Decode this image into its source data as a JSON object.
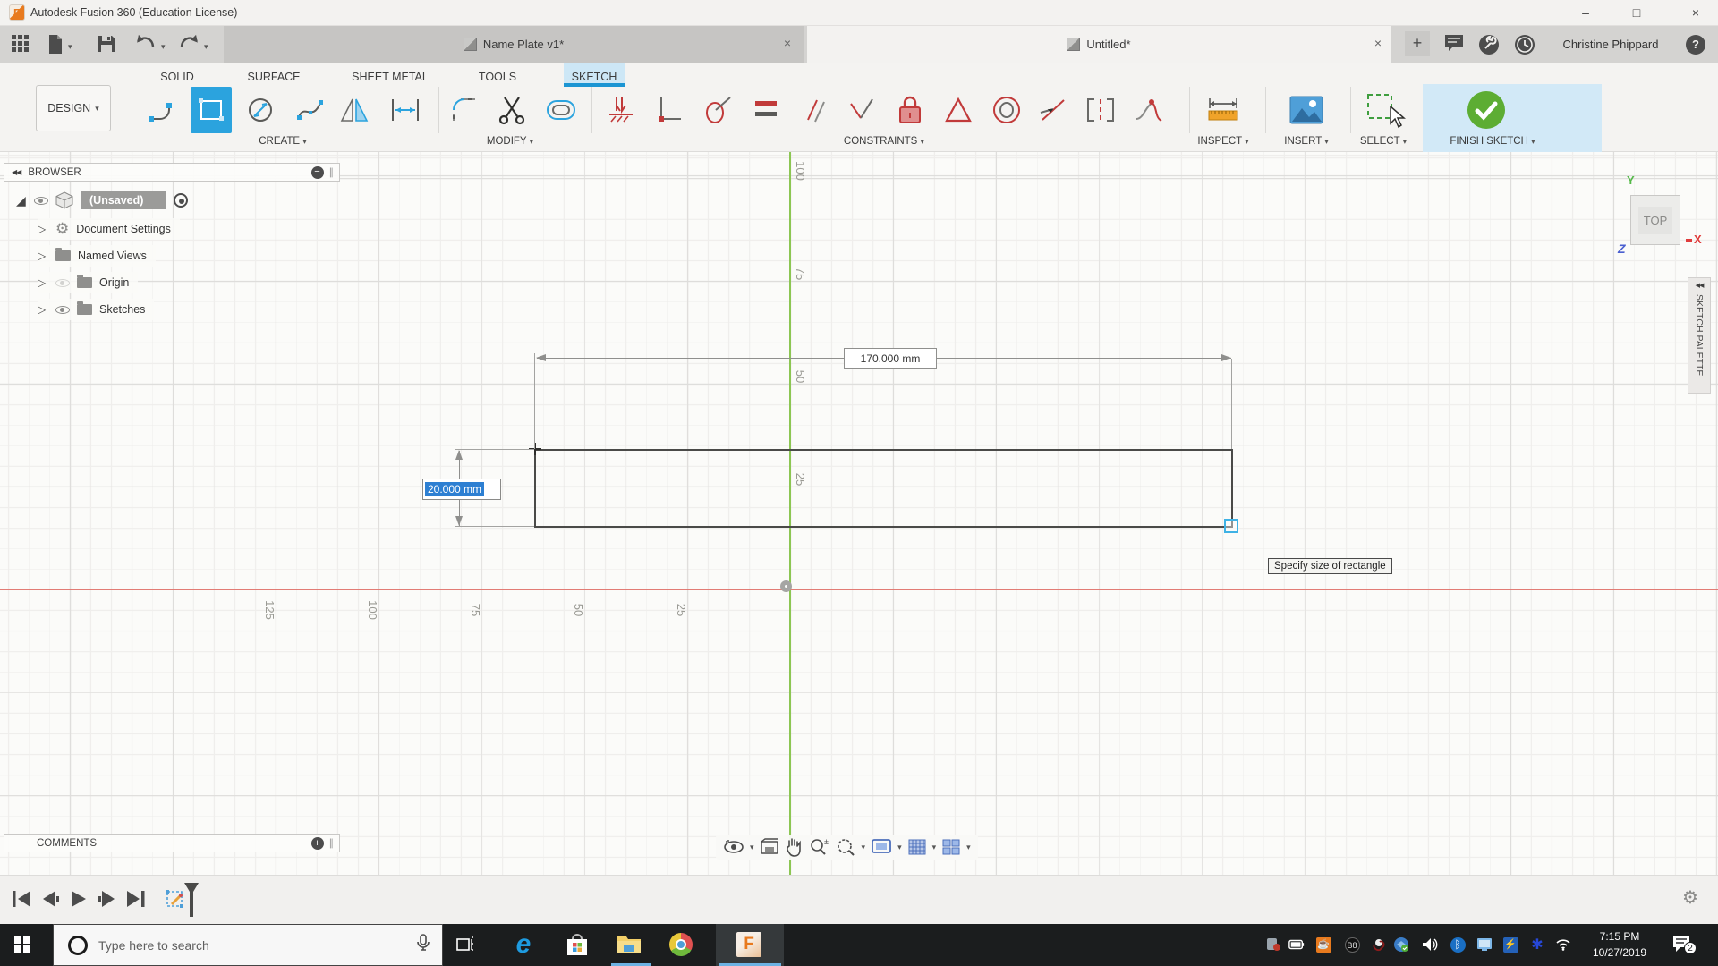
{
  "glyphs": {
    "caret": "▾",
    "expander": "▷",
    "root_expander": "◢",
    "close": "×",
    "minimize": "–",
    "maximize": "□",
    "plus": "+",
    "help": "?",
    "gear": "⚙",
    "target": "◉",
    "collapse_left": "◀◀",
    "handle": "∥",
    "add": "+",
    "minus": "−"
  },
  "window": {
    "title": "Autodesk Fusion 360 (Education License)"
  },
  "tabbar": {
    "tab1": "Name Plate v1*",
    "tab2": "Untitled*",
    "user": "Christine Phippard"
  },
  "ribbon": {
    "design": "DESIGN",
    "tabs": {
      "solid": "SOLID",
      "surface": "SURFACE",
      "sheet_metal": "SHEET METAL",
      "tools": "TOOLS",
      "sketch": "SKETCH"
    },
    "groups": {
      "create": "CREATE",
      "modify": "MODIFY",
      "constraints": "CONSTRAINTS",
      "inspect": "INSPECT",
      "insert": "INSERT",
      "select": "SELECT",
      "finish": "FINISH SKETCH"
    }
  },
  "browser": {
    "title": "BROWSER",
    "root_label": "(Unsaved)",
    "items": [
      {
        "label": "Document Settings"
      },
      {
        "label": "Named Views"
      },
      {
        "label": "Origin"
      },
      {
        "label": "Sketches"
      }
    ]
  },
  "canvas": {
    "length_dim": "170.000 mm",
    "width_input": "20.000 mm",
    "tooltip": "Specify size of rectangle",
    "x_labels": [
      "125",
      "100",
      "75",
      "50",
      "25"
    ],
    "y_labels": [
      "100",
      "75",
      "50",
      "25"
    ],
    "viewcube": {
      "face": "TOP",
      "x": "X",
      "y": "Y",
      "z": "Z"
    },
    "palette": "SKETCH PALETTE"
  },
  "comments": {
    "title": "COMMENTS"
  },
  "taskbar": {
    "search": "Type here to search",
    "time": "7:15 PM",
    "date": "10/27/2019",
    "badge": "2"
  }
}
